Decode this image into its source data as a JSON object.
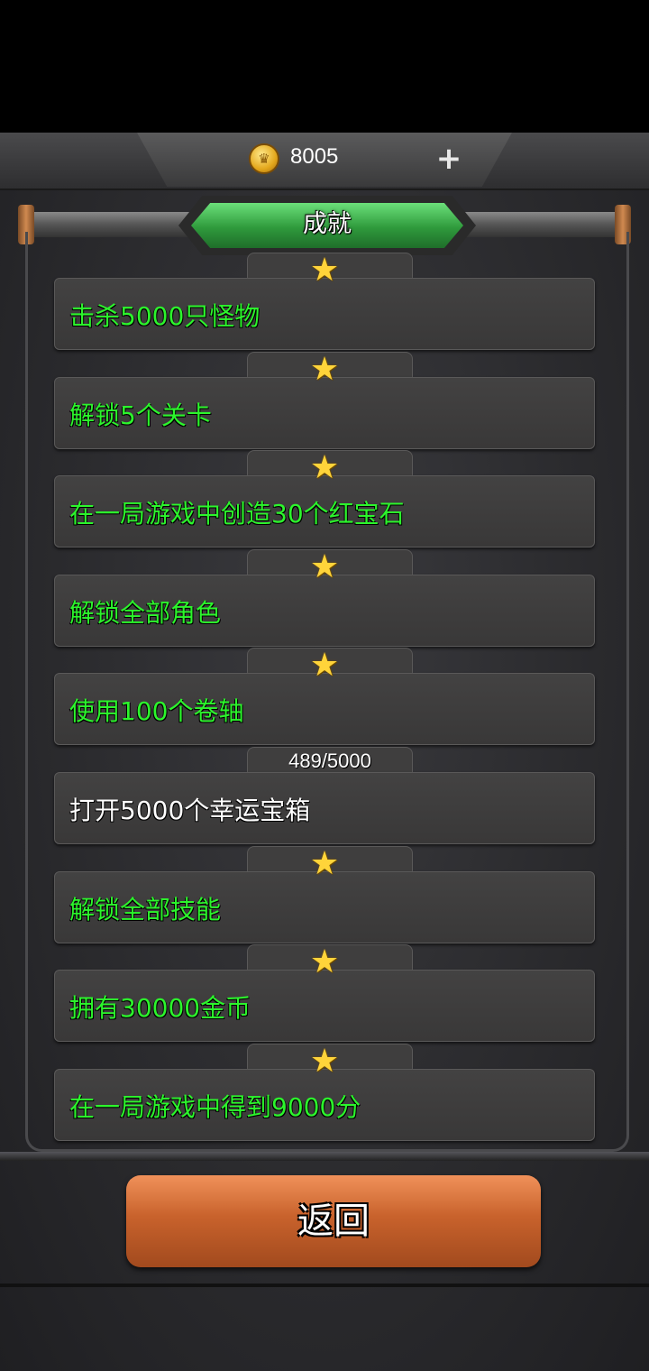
{
  "header": {
    "coins": "8005",
    "plus_label": "+",
    "coin_icon": "crown-coin-icon"
  },
  "title": "成就",
  "achievements": [
    {
      "label": "击杀5000只怪物",
      "status": "completed",
      "badge": "★"
    },
    {
      "label": "解锁5个关卡",
      "status": "completed",
      "badge": "★"
    },
    {
      "label": "在一局游戏中创造30个红宝石",
      "status": "completed",
      "badge": "★"
    },
    {
      "label": "解锁全部角色",
      "status": "completed",
      "badge": "★"
    },
    {
      "label": "使用100个卷轴",
      "status": "completed",
      "badge": "★"
    },
    {
      "label": "打开5000个幸运宝箱",
      "status": "in-progress",
      "progress": "489/5000"
    },
    {
      "label": "解锁全部技能",
      "status": "completed",
      "badge": "★"
    },
    {
      "label": "拥有30000金币",
      "status": "completed",
      "badge": "★"
    },
    {
      "label": "在一局游戏中得到9000分",
      "status": "completed",
      "badge": "★"
    }
  ],
  "back_button": "返回",
  "colors": {
    "completed_text": "#2cf52c",
    "pending_text": "#ffffff",
    "accent_green": "#3fb84c",
    "button_orange": "#d06a32"
  }
}
